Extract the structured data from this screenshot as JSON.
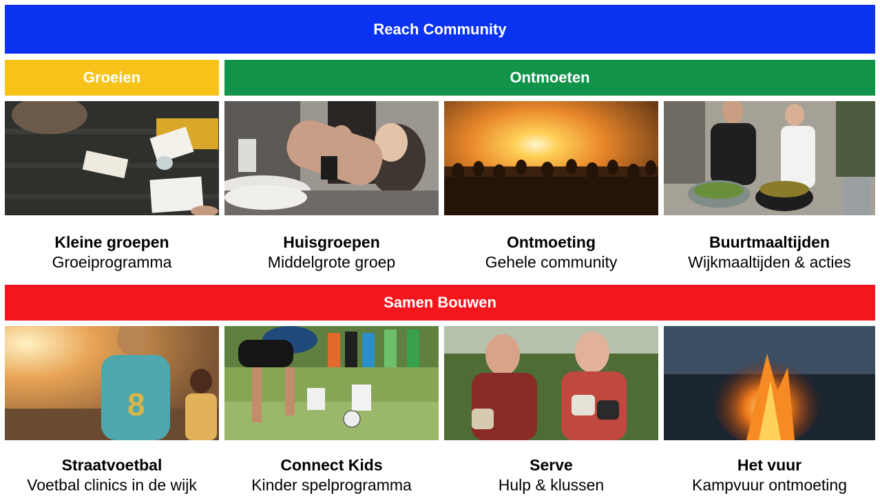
{
  "header": {
    "title": "Reach Community",
    "color": "#0b32f0"
  },
  "groeien": {
    "label": "Groeien",
    "color": "#f7c318"
  },
  "ontmoeten": {
    "label": "Ontmoeten",
    "color": "#12934a"
  },
  "samen": {
    "label": "Samen Bouwen",
    "color": "#f5151c"
  },
  "row1": [
    {
      "title": "Kleine groepen",
      "subtitle": "Groeiprogramma",
      "photo": "study-table-photo"
    },
    {
      "title": "Huisgroepen",
      "subtitle": "Middelgrote groep",
      "photo": "family-dinner-photo"
    },
    {
      "title": "Ontmoeting",
      "subtitle": "Gehele community",
      "photo": "sunset-crowd-photo"
    },
    {
      "title": "Buurtmaaltijden",
      "subtitle": "Wijkmaaltijden & acties",
      "photo": "cooking-photo"
    }
  ],
  "row2": [
    {
      "title": "Straatvoetbal",
      "subtitle": "Voetbal clinics in de wijk",
      "photo": "street-football-photo"
    },
    {
      "title": "Connect Kids",
      "subtitle": "Kinder spelprogramma",
      "photo": "kids-football-photo"
    },
    {
      "title": "Serve",
      "subtitle": "Hulp & klussen",
      "photo": "gardening-men-photo"
    },
    {
      "title": "Het vuur",
      "subtitle": "Kampvuur ontmoeting",
      "photo": "campfire-photo"
    }
  ]
}
